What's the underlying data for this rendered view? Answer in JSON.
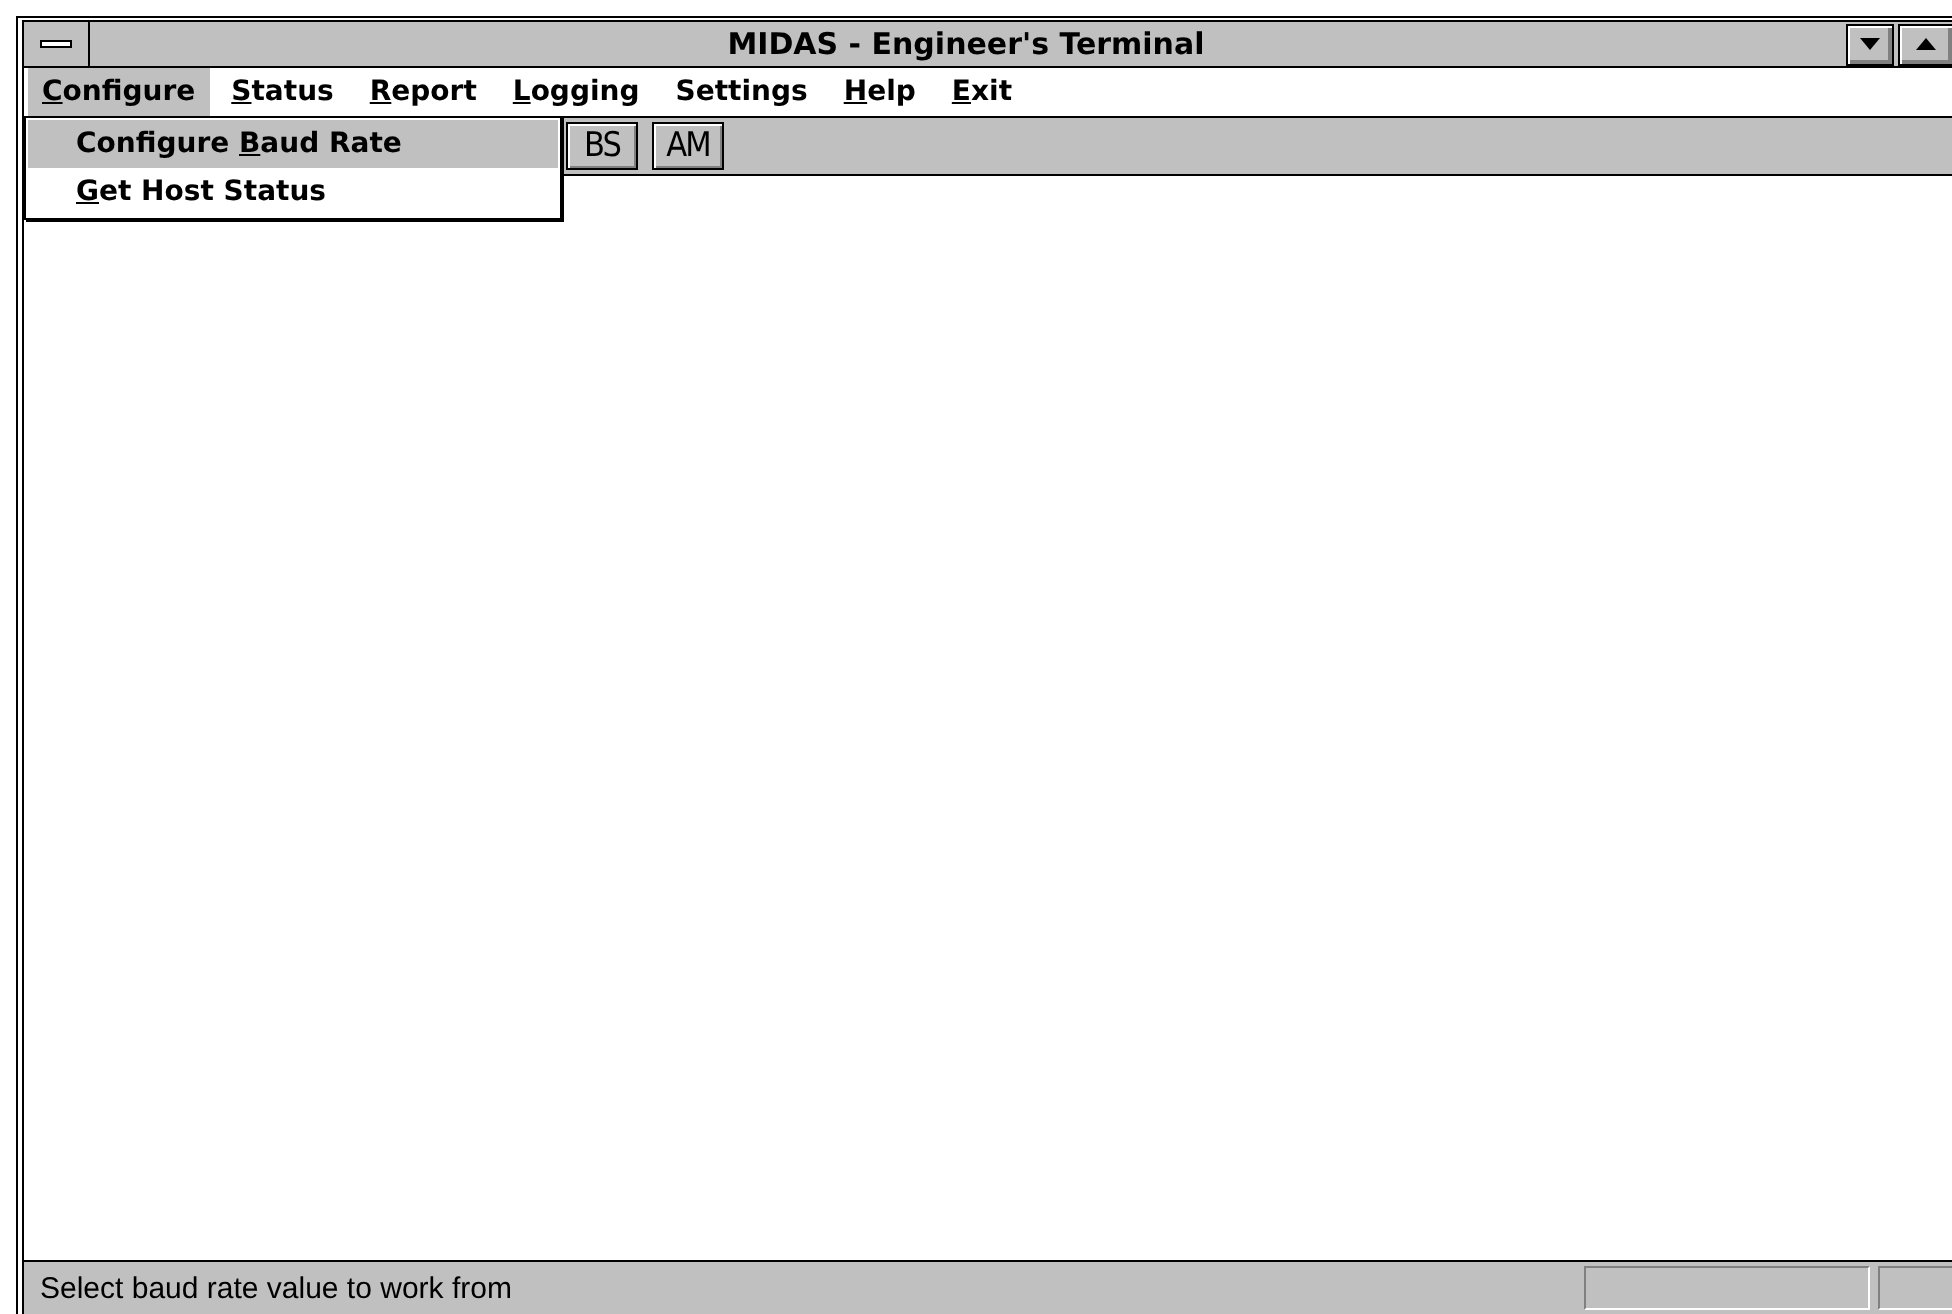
{
  "window": {
    "title": "MIDAS - Engineer's Terminal"
  },
  "menu_bar": [
    {
      "key": "C",
      "after": "onfigure",
      "selected": true
    },
    {
      "key": "S",
      "after": "tatus",
      "selected": false
    },
    {
      "key": "R",
      "after": "eport",
      "selected": false
    },
    {
      "key": "L",
      "after": "ogging",
      "selected": false
    },
    {
      "before": "Settings",
      "selected": false
    },
    {
      "key": "H",
      "after": "elp",
      "selected": false
    },
    {
      "key": "E",
      "after": "xit",
      "selected": false
    }
  ],
  "dropdown": [
    {
      "before": "Configure ",
      "key": "B",
      "after": "aud Rate",
      "selected": true
    },
    {
      "key": "G",
      "after": "et Host Status",
      "selected": false
    }
  ],
  "toolbar": [
    "BS",
    "AM"
  ],
  "status_bar": {
    "message": "Select baud rate value to work from"
  }
}
